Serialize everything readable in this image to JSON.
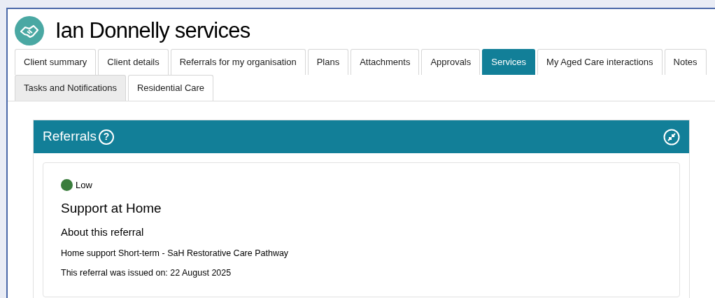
{
  "header": {
    "title": "Ian Donnelly services"
  },
  "tabs": [
    {
      "label": "Client summary",
      "selected": false,
      "highlighted": false
    },
    {
      "label": "Client details",
      "selected": false,
      "highlighted": false
    },
    {
      "label": "Referrals for my organisation",
      "selected": false,
      "highlighted": false
    },
    {
      "label": "Plans",
      "selected": false,
      "highlighted": false
    },
    {
      "label": "Attachments",
      "selected": false,
      "highlighted": false
    },
    {
      "label": "Approvals",
      "selected": false,
      "highlighted": false
    },
    {
      "label": "Services",
      "selected": true,
      "highlighted": false
    },
    {
      "label": "My Aged Care interactions",
      "selected": false,
      "highlighted": false
    },
    {
      "label": "Notes",
      "selected": false,
      "highlighted": false
    },
    {
      "label": "Tasks and Notifications",
      "selected": false,
      "highlighted": true
    },
    {
      "label": "Residential Care",
      "selected": false,
      "highlighted": false
    }
  ],
  "panel": {
    "title": "Referrals",
    "help": "?",
    "referral": {
      "priority": "Low",
      "color": "#3a7d3c",
      "title": "Support at Home",
      "subtitle": "About this referral",
      "service": "Home support Short-term - SaH Restorative Care Pathway",
      "issued": "This referral was issued on: 22 August 2025"
    }
  }
}
